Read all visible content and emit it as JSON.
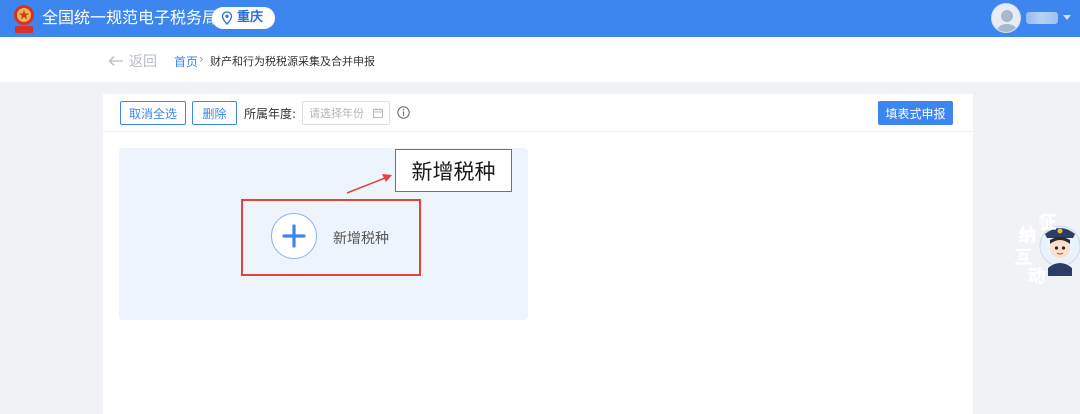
{
  "header": {
    "site_title": "全国统一规范电子税务局",
    "region": "重庆",
    "emblem_icon": "tax-emblem-icon",
    "brand_color": "#3d86f0"
  },
  "breadcrumb": {
    "back_label": "返回",
    "home": "首页",
    "separator": "›",
    "current": "财产和行为税税源采集及合并申报"
  },
  "toolbar": {
    "cancel_select_all": "取消全选",
    "delete": "删除",
    "year_label": "所属年度:",
    "year_placeholder": "请选择年份",
    "fill_declare": "填表式申报"
  },
  "card": {
    "add_label": "新增税种"
  },
  "annotation": {
    "callout_text": "新增税种",
    "color": "#e0443c"
  },
  "float_widget": {
    "chars": [
      "征",
      "纳",
      "互",
      "动"
    ]
  }
}
